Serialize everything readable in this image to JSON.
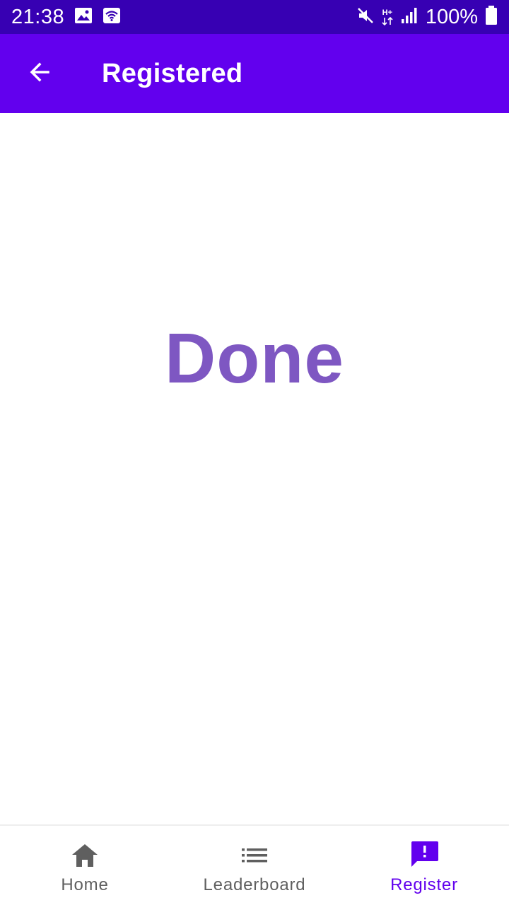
{
  "status_bar": {
    "time": "21:38",
    "battery_percent": "100%",
    "network_type": "H+",
    "icons": [
      "image-notification-icon",
      "wifi-icon",
      "mute-icon",
      "signal-icon",
      "battery-icon"
    ]
  },
  "app_bar": {
    "title": "Registered",
    "back_icon": "arrow-back-icon"
  },
  "main": {
    "message": "Done"
  },
  "bottom_nav": {
    "items": [
      {
        "label": "Home",
        "icon": "home-icon",
        "active": false
      },
      {
        "label": "Leaderboard",
        "icon": "list-icon",
        "active": false
      },
      {
        "label": "Register",
        "icon": "feedback-icon",
        "active": true
      }
    ]
  },
  "colors": {
    "status_bar": "#3700B3",
    "app_bar": "#6200EE",
    "done_text": "#7E57C2",
    "nav_active": "#6200EE",
    "nav_inactive": "#5f5f5f"
  }
}
